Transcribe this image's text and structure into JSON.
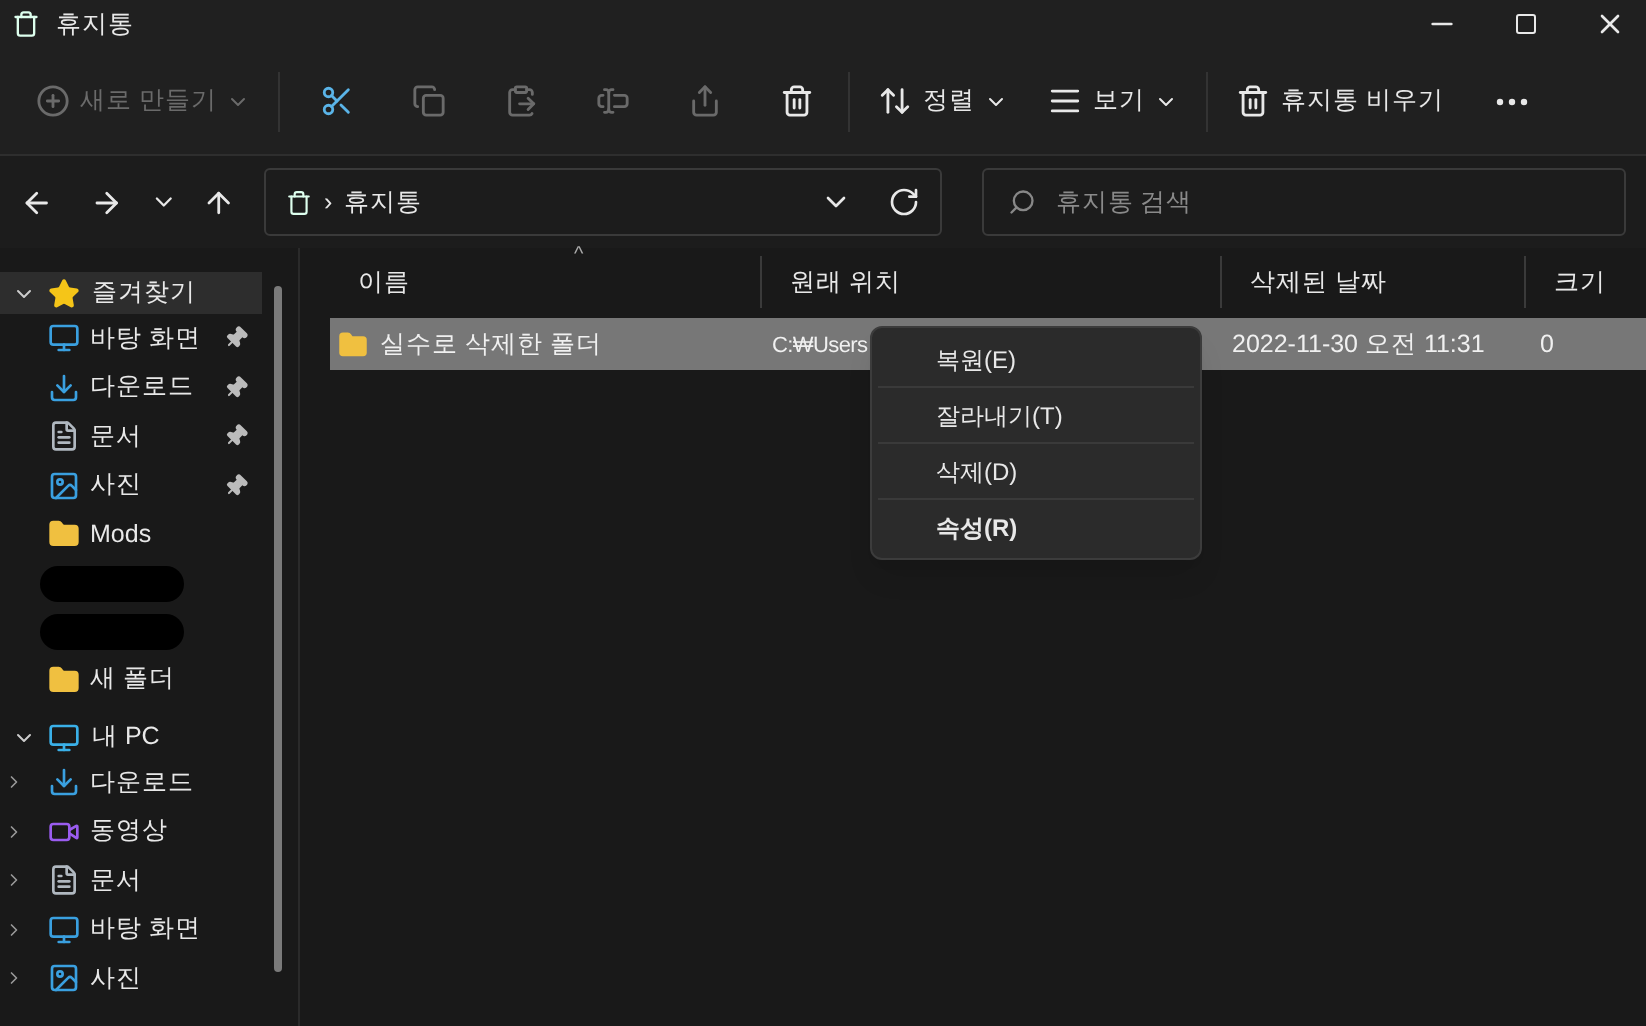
{
  "window": {
    "title": "휴지통"
  },
  "toolbar": [
    {
      "kind": "new",
      "label": "새로 만들기",
      "dropdown": true,
      "disabled": true
    },
    {
      "kind": "cut",
      "disabled": false
    },
    {
      "kind": "copy",
      "disabled": true
    },
    {
      "kind": "paste",
      "disabled": true
    },
    {
      "kind": "rename",
      "disabled": true
    },
    {
      "kind": "share",
      "disabled": true
    },
    {
      "kind": "delete",
      "disabled": false
    },
    {
      "kind": "sort",
      "label": "정렬",
      "dropdown": true,
      "disabled": false
    },
    {
      "kind": "view",
      "label": "보기",
      "dropdown": true,
      "disabled": false
    },
    {
      "kind": "empty",
      "label": "휴지통 비우기",
      "dropdown": false,
      "disabled": false
    },
    {
      "kind": "more",
      "disabled": false
    }
  ],
  "address": {
    "separator": "›",
    "path": "휴지통"
  },
  "search": {
    "placeholder": "휴지통 검색"
  },
  "sidebar": [
    {
      "kind": "star",
      "label": "즐겨찾기",
      "expanded": true,
      "selected": true,
      "children": [
        {
          "kind": "desktop",
          "label": "바탕 화면",
          "pinned": true
        },
        {
          "kind": "download",
          "label": "다운로드",
          "pinned": true
        },
        {
          "kind": "document",
          "label": "문서",
          "pinned": true
        },
        {
          "kind": "picture",
          "label": "사진",
          "pinned": true
        },
        {
          "kind": "folder",
          "label": "Mods",
          "pinned": false
        },
        {
          "kind": "redacted"
        },
        {
          "kind": "redacted"
        },
        {
          "kind": "folder",
          "label": "새 폴더",
          "pinned": false
        }
      ]
    },
    {
      "kind": "pc",
      "label": "내 PC",
      "expanded": true,
      "selected": false,
      "children": [
        {
          "kind": "download",
          "label": "다운로드",
          "expandable": true
        },
        {
          "kind": "video",
          "label": "동영상",
          "expandable": true
        },
        {
          "kind": "document",
          "label": "문서",
          "expandable": true
        },
        {
          "kind": "desktop",
          "label": "바탕 화면",
          "expandable": true
        },
        {
          "kind": "picture",
          "label": "사진",
          "expandable": true
        }
      ]
    }
  ],
  "table": {
    "sort_indicator": "^",
    "columns": [
      "이름",
      "원래 위치",
      "삭제된 날짜",
      "크기"
    ],
    "rows": [
      {
        "name": "실수로 삭제한 폴더",
        "location": "C:₩Users",
        "deleted": "2022-11-30 오전 11:31",
        "size": "0",
        "selected": true
      }
    ]
  },
  "context_menu": [
    {
      "label": "복원(E)",
      "default": false
    },
    {
      "label": "잘라내기(T)",
      "default": false
    },
    {
      "label": "삭제(D)",
      "default": false
    },
    {
      "label": "속성(R)",
      "default": true
    }
  ]
}
